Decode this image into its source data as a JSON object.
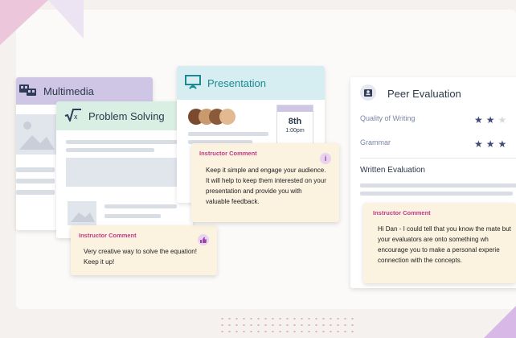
{
  "multimedia": {
    "title": "Multimedia",
    "icon": "film-icon"
  },
  "problem_solving": {
    "title": "Problem Solving",
    "icon": "square-root-icon",
    "comment": {
      "title": "Instructor Comment",
      "text": "Very creative way to solve the equation! Keep it up!",
      "badge_icon": "thumbs-up-icon"
    }
  },
  "presentation": {
    "title": "Presentation",
    "icon": "projector-icon",
    "date": {
      "day": "8th",
      "time": "1:00pm"
    },
    "comment": {
      "title": "Instructor Comment",
      "text": "Keep it simple and engage your audience. It will help to keep them interested on your presentation and provide you with valuable feedback.",
      "badge_icon": "info-icon"
    }
  },
  "peer_evaluation": {
    "title": "Peer Evaluation",
    "icon": "person-badge-icon",
    "criteria": [
      {
        "label": "Quality of Writing",
        "rating": 2,
        "shown_max": 3
      },
      {
        "label": "Grammar",
        "rating": 3,
        "shown_max": 3
      }
    ],
    "written_label": "Written Evaluation",
    "comment": {
      "title": "Instructor Comment",
      "text": "Hi Dan - I could tell that you know the mate but your evaluators are onto something wh encourage you to make a personal experie connection with the concepts."
    }
  },
  "colors": {
    "multimedia_header": "#cfc6e6",
    "problem_header": "#d9efe3",
    "presentation_header": "#d6edf1",
    "comment_bg": "#fbf2e0",
    "accent_pink": "#c2378a",
    "star": "#3e4a78"
  }
}
